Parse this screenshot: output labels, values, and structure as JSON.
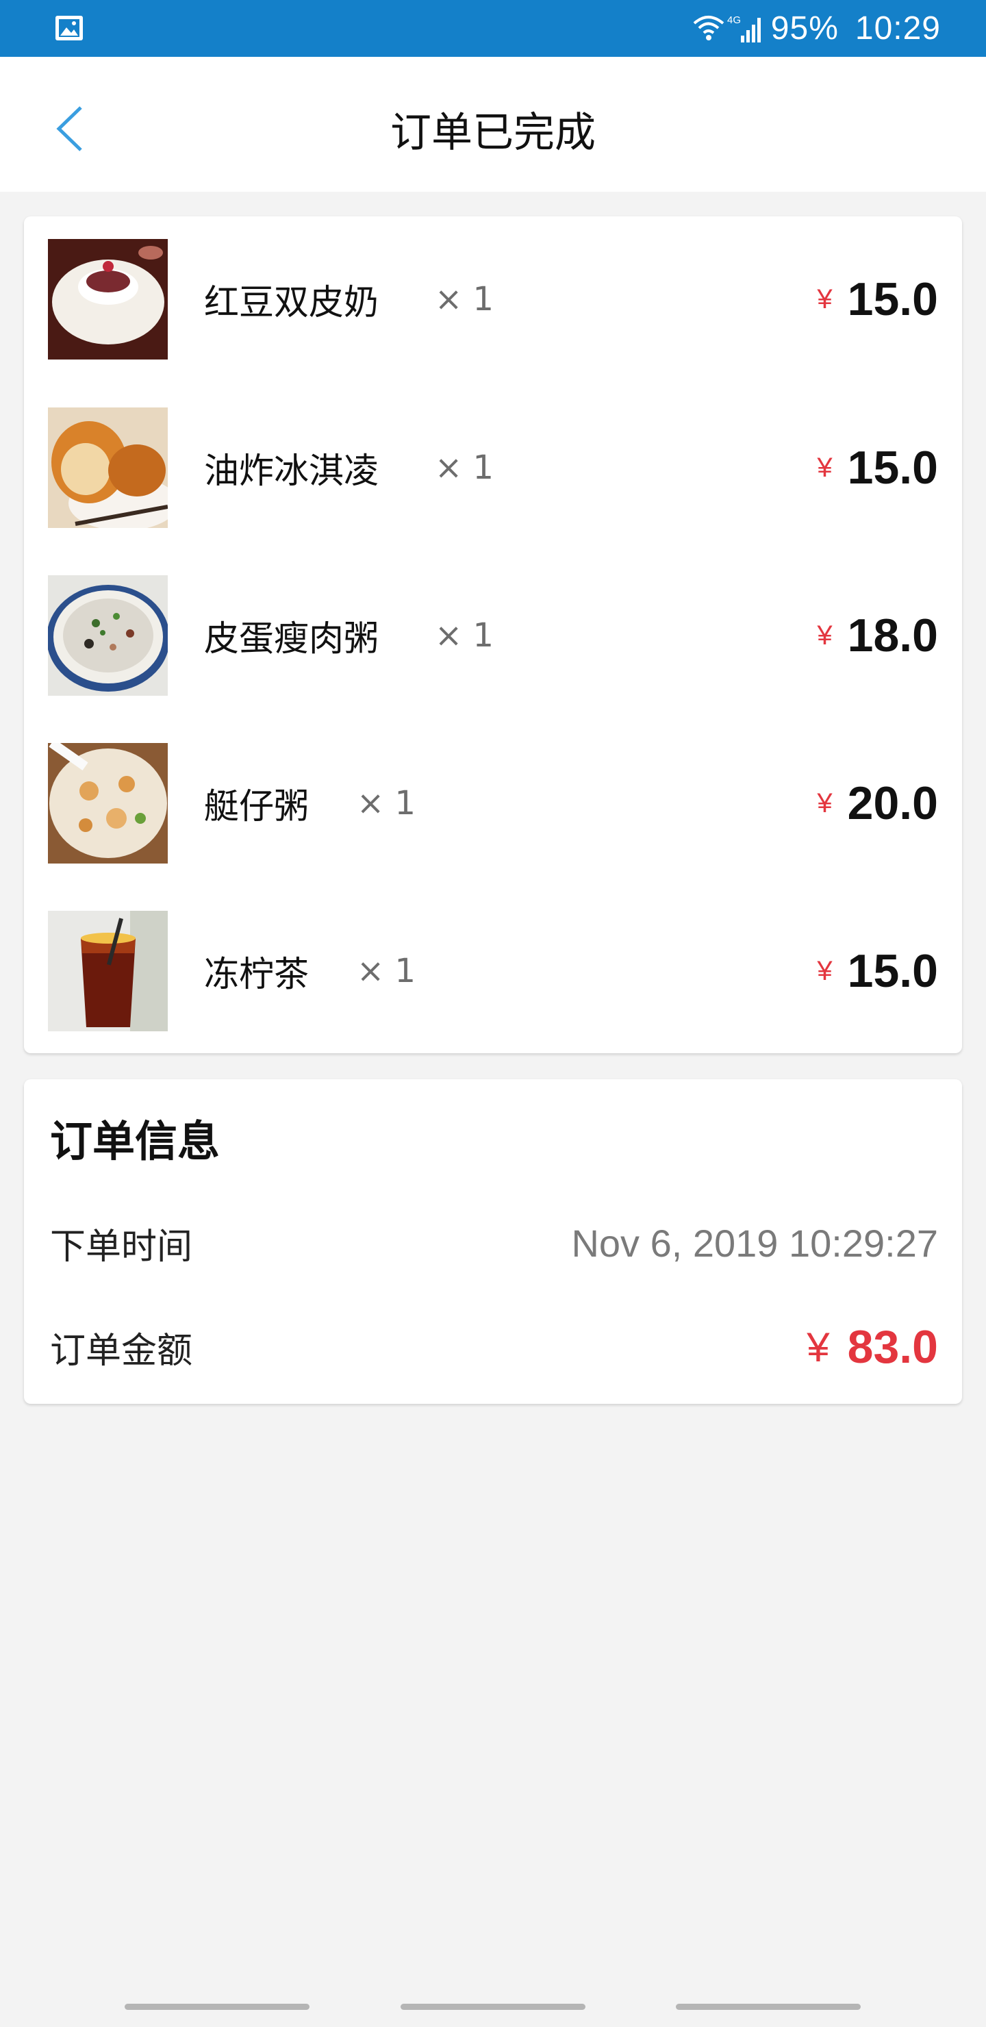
{
  "status_bar": {
    "battery": "95%",
    "time": "10:29",
    "network": "4G"
  },
  "header": {
    "title": "订单已完成"
  },
  "order_items": [
    {
      "name": "红豆双皮奶",
      "qty": "× 1",
      "currency": "¥",
      "price": "15.0"
    },
    {
      "name": "油炸冰淇凌",
      "qty": "× 1",
      "currency": "¥",
      "price": "15.0"
    },
    {
      "name": "皮蛋瘦肉粥",
      "qty": "× 1",
      "currency": "¥",
      "price": "18.0"
    },
    {
      "name": "艇仔粥",
      "qty": "× 1",
      "currency": "¥",
      "price": "20.0"
    },
    {
      "name": "冻柠茶",
      "qty": "× 1",
      "currency": "¥",
      "price": "15.0"
    }
  ],
  "order_info": {
    "title": "订单信息",
    "time_label": "下单时间",
    "time_value": "Nov 6, 2019 10:29:27",
    "amount_label": "订单金额",
    "amount_currency": "¥",
    "amount_value": "83.0"
  },
  "colors": {
    "status_bar": "#1480c9",
    "accent_red": "#e3363f",
    "back_arrow": "#3a9ee0"
  }
}
